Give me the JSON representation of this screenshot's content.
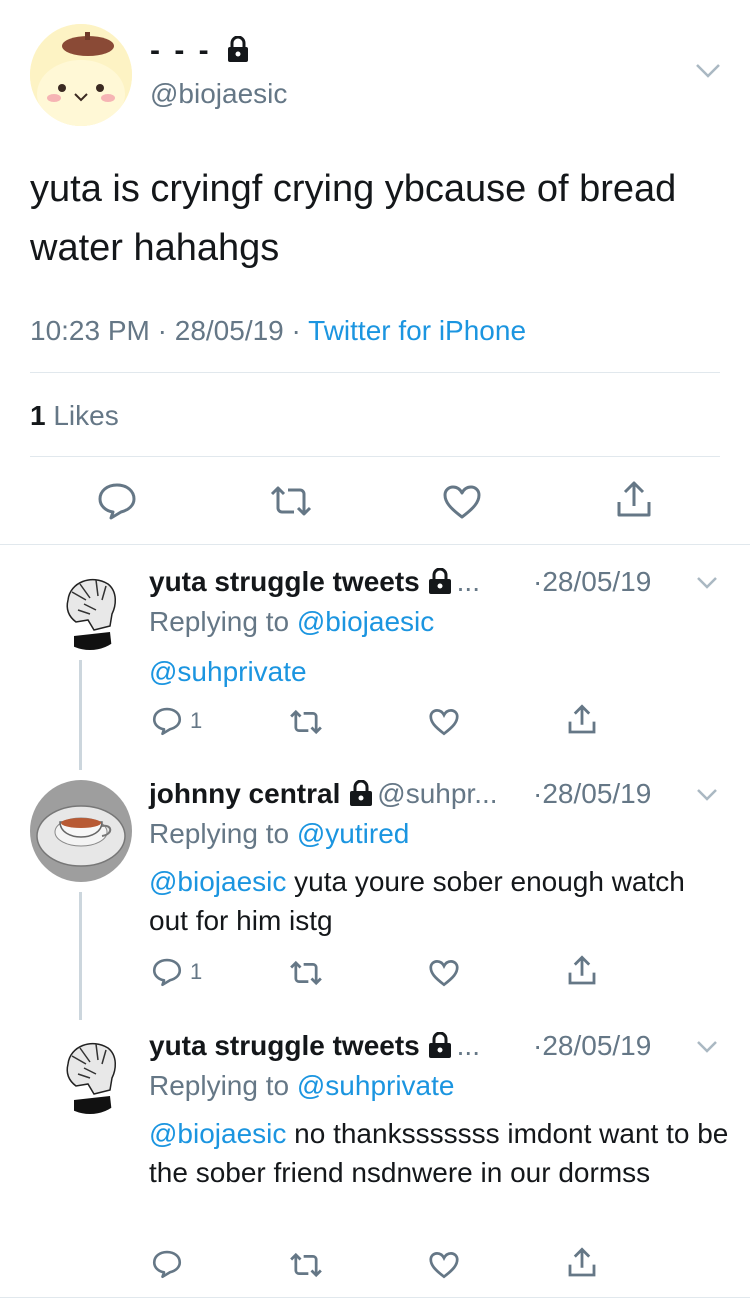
{
  "tweet": {
    "display_name": "- - -",
    "handle": "@biojaesic",
    "text": "yuta is cryingf crying ybcause of bread water hahahgs",
    "time": "10:23 PM",
    "date": "28/05/19",
    "source": "Twitter for iPhone",
    "likes_count": "1",
    "likes_label": "Likes"
  },
  "replies": [
    {
      "name": "yuta struggle tweets",
      "handle": "...",
      "date": "28/05/19",
      "replying_prefix": "Replying to",
      "replying_to": "@biojaesic",
      "mention": "@suhprivate",
      "text": "",
      "reply_count": "1"
    },
    {
      "name": "johnny central",
      "handle": "@suhpr...",
      "date": "28/05/19",
      "replying_prefix": "Replying to",
      "replying_to": "@yutired",
      "mention": "@biojaesic",
      "text": "yuta youre sober enough watch out for him istg",
      "reply_count": "1"
    },
    {
      "name": "yuta struggle tweets",
      "handle": "...",
      "date": "28/05/19",
      "replying_prefix": "Replying to",
      "replying_to": "@suhprivate",
      "mention": "@biojaesic",
      "text": "no thanksssssss imdont want to be the sober friend nsdnwere in our dormss",
      "reply_count": ""
    }
  ],
  "icons": {
    "reply": "reply-icon",
    "retweet": "retweet-icon",
    "like": "heart-icon",
    "share": "share-icon",
    "lock": "lock-icon",
    "more": "chevron-down-icon"
  },
  "colors": {
    "link": "#1b95e0",
    "muted": "#657786",
    "divider": "#e1e8ed"
  }
}
